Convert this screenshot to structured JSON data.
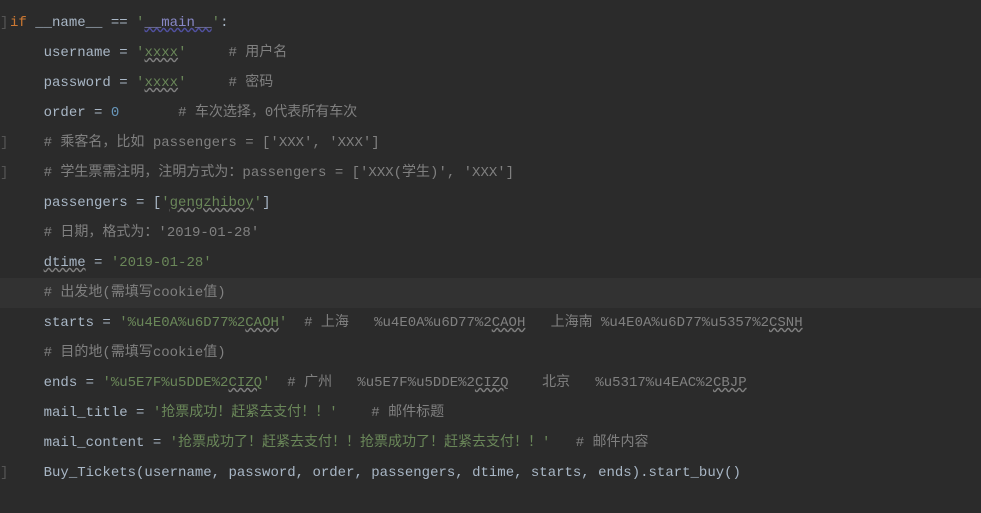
{
  "code": {
    "l1": {
      "kw1": "if",
      "name": " __name__ ",
      "eq": "== ",
      "str": "'",
      "main": "__main__",
      "str2": "'",
      "colon": ":"
    },
    "l2": {
      "indent": "    ",
      "var": "username",
      "op": " = ",
      "str": "'",
      "val": "xxxx",
      "str2": "'",
      "sp": "     ",
      "cmt": "# 用户名"
    },
    "l3": {
      "indent": "    ",
      "var": "password",
      "op": " = ",
      "str": "'",
      "val": "xxxx",
      "str2": "'",
      "sp": "     ",
      "cmt": "# 密码"
    },
    "l4": {
      "indent": "    ",
      "var": "order",
      "op": " = ",
      "num": "0",
      "sp": "       ",
      "cmt": "# 车次选择，0代表所有车次"
    },
    "l5": {
      "indent": "    ",
      "cmt": "# 乘客名，比如 passengers = ['XXX', 'XXX']"
    },
    "l6": {
      "indent": "    ",
      "cmt": "# 学生票需注明，注明方式为：passengers = ['XXX(学生)', 'XXX']"
    },
    "l7": {
      "indent": "    ",
      "var": "passengers",
      "op": " = [",
      "str": "'",
      "val": "gengzhiboy",
      "str2": "'",
      "close": "]"
    },
    "l8": {
      "indent": "    ",
      "cmt": "# 日期，格式为：'2019-01-28'"
    },
    "l9": {
      "indent": "    ",
      "var": "dtime",
      "op": " = ",
      "str": "'2019-01-28'"
    },
    "l10": {
      "indent": "    ",
      "cmt": "# 出发地(需填写cookie值)"
    },
    "l11": {
      "indent": "    ",
      "var": "starts",
      "op": " = ",
      "s1": "'%u4E0A%u6D77%2",
      "s2": "CAOH",
      "s3": "'",
      "sp1": "  ",
      "c1": "# 上海   %u4E0A%u6D77%2",
      "c2": "CAOH",
      "c3": "   上海南 %u4E0A%u6D77%u5357%2",
      "c4": "CSNH"
    },
    "l12": {
      "indent": "    ",
      "cmt": "# 目的地(需填写cookie值)"
    },
    "l13": {
      "indent": "    ",
      "var": "ends",
      "op": " = ",
      "s1": "'%u5E7F%u5DDE%2",
      "s2": "CIZQ",
      "s3": "'",
      "sp1": "  ",
      "c1": "# 广州   %u5E7F%u5DDE%2",
      "c2": "CIZQ",
      "c3": "    北京   %u5317%u4EAC%2",
      "c4": "CBJP"
    },
    "l14": {
      "indent": "    ",
      "var": "mail_title",
      "op": " = ",
      "str": "'抢票成功！赶紧去支付！！'",
      "sp": "    ",
      "cmt": "# 邮件标题"
    },
    "l15": {
      "indent": "    ",
      "var": "mail_content",
      "op": " = ",
      "str": "'抢票成功了！赶紧去支付！！抢票成功了！赶紧去支付！！'",
      "sp": "   ",
      "cmt": "# 邮件内容"
    },
    "l16": {
      "indent": "    ",
      "fn": "Buy_Tickets",
      "args": "(username, password, order, passengers, dtime, starts, ends).start_buy()"
    }
  },
  "gutter": {
    "fold1": "]",
    "fold2": "]",
    "fold3": "]",
    "fold4": "]"
  }
}
